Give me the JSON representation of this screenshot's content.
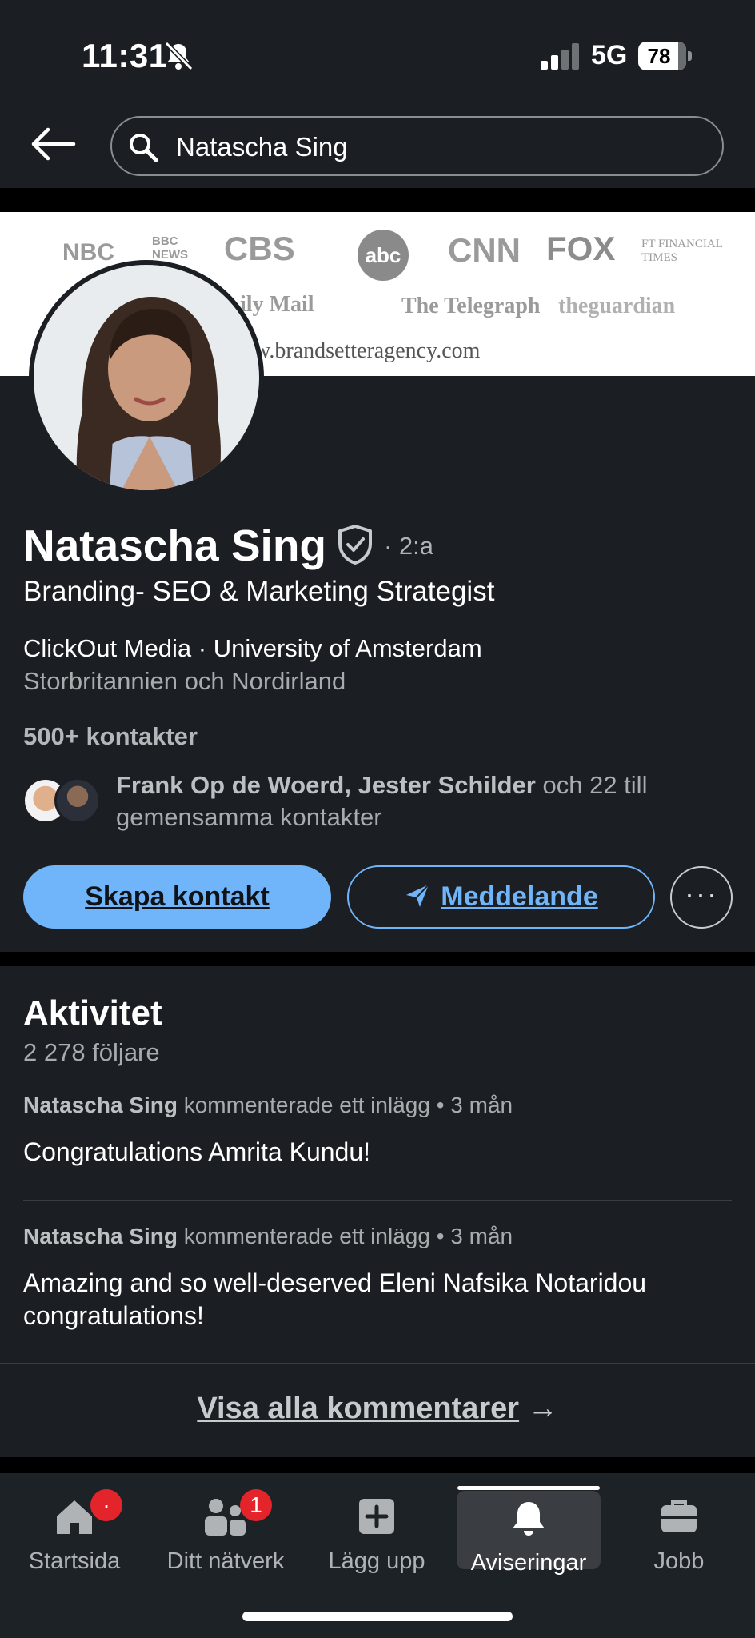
{
  "status_bar": {
    "time": "11:31",
    "network": "5G",
    "battery": "78"
  },
  "search": {
    "query": "Natascha Sing"
  },
  "banner": {
    "logos": [
      "NBC",
      "BBC NEWS",
      "CBS",
      "abc",
      "CNN",
      "FOX",
      "FT FINANCIAL TIMES",
      "ily Mail",
      "The Telegraph",
      "theguardian"
    ],
    "url": "w.brandsetteragency.com"
  },
  "profile": {
    "name": "Natascha Sing",
    "degree": "· 2:a",
    "headline": "Branding- SEO & Marketing Strategist",
    "company_line": "ClickOut Media · University of Amsterdam",
    "location": "Storbritannien och Nordirland",
    "connections": "500+ kontakter",
    "mutual_names": "Frank Op de Woerd, Jester Schilder",
    "mutual_rest": " och 22 till gemensamma kontakter"
  },
  "actions": {
    "connect": "Skapa kontakt",
    "message": "Meddelande",
    "more": "···"
  },
  "activity": {
    "title": "Aktivitet",
    "followers": "2 278 följare",
    "posts": [
      {
        "author": "Natascha Sing",
        "action": " kommenterade ett inlägg • 3 mån",
        "text": "Congratulations Amrita Kundu!"
      },
      {
        "author": "Natascha Sing",
        "action": " kommenterade ett inlägg • 3 mån",
        "text": "Amazing and so well-deserved Eleni Nafsika Notaridou congratulations!"
      }
    ],
    "show_all": "Visa alla kommentarer",
    "show_all_arrow": "→"
  },
  "nav": {
    "items": [
      {
        "label": "Startsida",
        "icon": "home-icon",
        "badge": "·"
      },
      {
        "label": "Ditt nätverk",
        "icon": "network-icon",
        "badge": "1"
      },
      {
        "label": "Lägg upp",
        "icon": "add-post-icon"
      },
      {
        "label": "Aviseringar",
        "icon": "bell-icon",
        "active": true
      },
      {
        "label": "Jobb",
        "icon": "briefcase-icon"
      }
    ]
  },
  "colors": {
    "background": "#1b1f23",
    "accent": "#70b5f9",
    "badge": "#e3252b"
  }
}
